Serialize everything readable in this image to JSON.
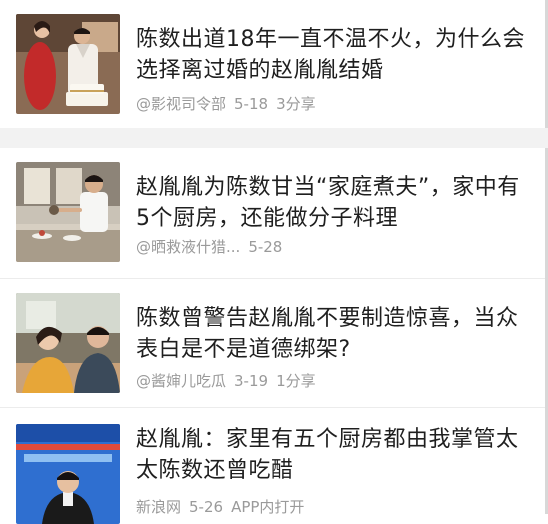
{
  "feed": {
    "items": [
      {
        "title": "陈数出道18年一直不温不火，为什么会选择离过婚的赵胤胤结婚",
        "source": "@影视司令部",
        "date": "5-18",
        "shares": "3分享",
        "image": "couple-cake-photo"
      },
      {
        "title": "赵胤胤为陈数甘当“家庭煮夫”，家中有5个厨房，还能做分子料理",
        "source": "@晒救液什猎...",
        "date": "5-28",
        "shares": "",
        "image": "man-in-kitchen-photo"
      },
      {
        "title": "陈数曾警告赵胤胤不要制造惊喜，当众表白是不是道德绑架?",
        "source": "@酱婶儿吃瓜",
        "date": "3-19",
        "shares": "1分享",
        "image": "couple-smiling-photo"
      },
      {
        "title": "赵胤胤：家里有五个厨房都由我掌管太太陈数还曾吃醋",
        "source": "新浪网",
        "date": "5-26",
        "shares": "APP内打开",
        "image": "tv-show-host-photo"
      }
    ]
  },
  "colors": {
    "title": "#1f1f1f",
    "meta": "#9a9a9a",
    "divider": "#ececec",
    "gap": "#f2f2f2"
  }
}
